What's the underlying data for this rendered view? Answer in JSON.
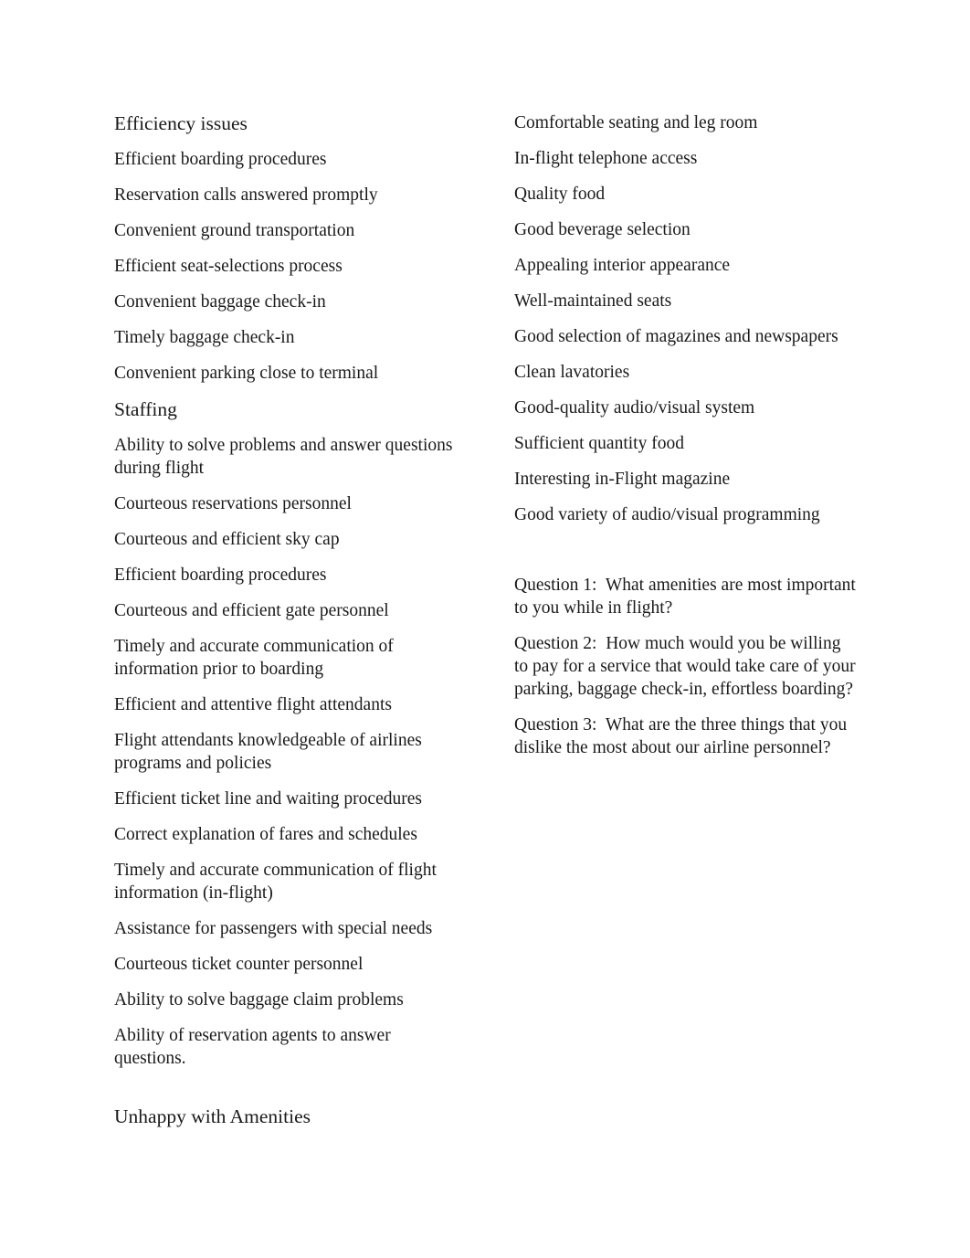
{
  "document": {
    "background_color": "#ffffff",
    "text_color": "#1a1a1a"
  },
  "left_column": {
    "blocks": [
      {
        "type": "heading",
        "text": "Efficiency issues"
      },
      {
        "type": "para",
        "text": "Efficient boarding procedures"
      },
      {
        "type": "para",
        "text": "Reservation calls answered promptly"
      },
      {
        "type": "para",
        "text": "Convenient ground transportation"
      },
      {
        "type": "para",
        "text": "Efficient seat-selections process"
      },
      {
        "type": "para",
        "text": "Convenient baggage check-in"
      },
      {
        "type": "para",
        "text": "Timely baggage check-in"
      },
      {
        "type": "para",
        "text": "Convenient parking close to terminal"
      },
      {
        "type": "heading",
        "text": "Staffing"
      },
      {
        "type": "para",
        "text": "Ability to solve problems and answer questions during flight"
      },
      {
        "type": "para",
        "text": "Courteous reservations personnel"
      },
      {
        "type": "para",
        "text": "Courteous and efficient sky cap"
      },
      {
        "type": "para",
        "text": "Efficient boarding procedures"
      },
      {
        "type": "para",
        "text": "Courteous and efficient gate personnel"
      },
      {
        "type": "para",
        "text": "Timely and accurate communication of information prior to boarding"
      },
      {
        "type": "para",
        "text": "Efficient and attentive flight attendants"
      },
      {
        "type": "para",
        "text": "Flight attendants knowledgeable of airlines programs and policies"
      },
      {
        "type": "para",
        "text": "Efficient ticket line and waiting procedures"
      },
      {
        "type": "para",
        "text": "Correct explanation of fares and schedules"
      },
      {
        "type": "para",
        "text": "Timely and accurate communication of flight information (in-flight)"
      },
      {
        "type": "para",
        "text": "Assistance for passengers with special needs"
      },
      {
        "type": "para",
        "text": "Courteous ticket counter personnel"
      },
      {
        "type": "para",
        "text": "Ability to solve baggage claim problems"
      },
      {
        "type": "para",
        "text": "Ability of reservation agents to answer questions."
      },
      {
        "type": "spacer",
        "text": ""
      },
      {
        "type": "heading",
        "text": "Unhappy with Amenities"
      }
    ]
  },
  "right_column": {
    "blocks": [
      {
        "type": "para",
        "text": "Comfortable seating and leg room"
      },
      {
        "type": "para",
        "text": "In-flight telephone access"
      },
      {
        "type": "para",
        "text": "Quality food"
      },
      {
        "type": "para",
        "text": "Good beverage selection"
      },
      {
        "type": "para",
        "text": "Appealing interior appearance"
      },
      {
        "type": "para",
        "text": "Well-maintained seats"
      },
      {
        "type": "para",
        "text": "Good selection of magazines and newspapers"
      },
      {
        "type": "para",
        "text": "Clean lavatories"
      },
      {
        "type": "para",
        "text": "Good-quality audio/visual system"
      },
      {
        "type": "para",
        "text": "Sufficient quantity food"
      },
      {
        "type": "para",
        "text": "Interesting in-Flight magazine"
      },
      {
        "type": "para",
        "text": "Good variety of audio/visual programming"
      },
      {
        "type": "spacer-lg",
        "text": ""
      },
      {
        "type": "para",
        "text": "Question 1:  What amenities are most important to you while in flight?"
      },
      {
        "type": "para",
        "text": "Question 2:  How much would you be willing to pay for a service that would take care of your parking, baggage check-in, effortless boarding?"
      },
      {
        "type": "para",
        "text": "Question 3:  What are the three things that you dislike the most about our airline personnel?"
      }
    ]
  }
}
